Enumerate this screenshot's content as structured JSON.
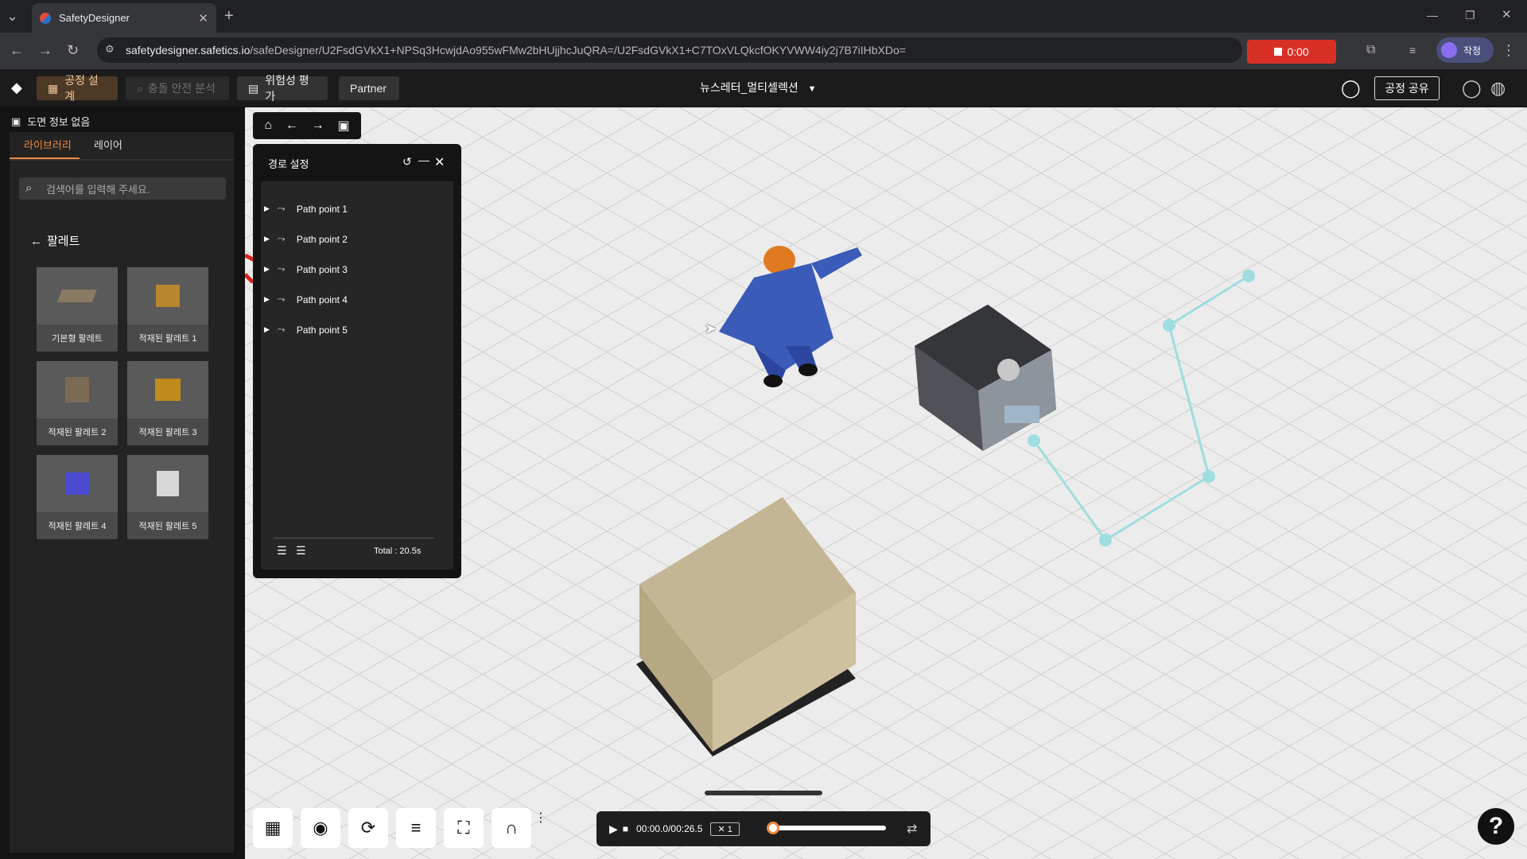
{
  "browser": {
    "tab_title": "SafetyDesigner",
    "url_domain": "safetydesigner.safetics.io",
    "url_path": "/safeDesigner/U2FsdGVkX1+NPSq3HcwjdAo955wFMw2bHUjjhcJuQRA=/U2FsdGVkX1+C7TOxVLQkcfOKYVWW4iy2j7B7iIHbXDo=",
    "recording_time": "0:00",
    "profile_label": "작정"
  },
  "header": {
    "mode_design": "공정 설계",
    "mode_collision": "충돌 안전 분석",
    "mode_risk": "위험성 평가",
    "partner": "Partner",
    "project_name": "뉴스레터_멀티셀렉션",
    "share_button": "공정 공유"
  },
  "sidebar": {
    "drawing_info": "도면 정보 없음",
    "tabs": [
      "라이브러리",
      "레이어"
    ],
    "search_placeholder": "검색어를 입력해 주세요.",
    "category": "팔레트",
    "items": [
      {
        "label": "기본형 팔레트",
        "color": "#8a7a62"
      },
      {
        "label": "적재된 팔레트 1",
        "color": "#b8862e"
      },
      {
        "label": "적재된 팔레트 2",
        "color": "#7c6a55"
      },
      {
        "label": "적재된 팔레트 3",
        "color": "#c08b1c"
      },
      {
        "label": "적재된 팔레트 4",
        "color": "#4a4ad0"
      },
      {
        "label": "적재된 팔레트 5",
        "color": "#d8d8d8"
      }
    ]
  },
  "path_panel": {
    "title": "경로 설정",
    "points": [
      "Path point 1",
      "Path point 2",
      "Path point 3",
      "Path point 4",
      "Path point 5"
    ],
    "total": "Total : 20.5s"
  },
  "player": {
    "time": "00:00.0/00:26.5",
    "speed": "✕ 1"
  },
  "colors": {
    "accent": "#f08a3e",
    "path_line": "#9fdde0",
    "record": "#d93025"
  }
}
